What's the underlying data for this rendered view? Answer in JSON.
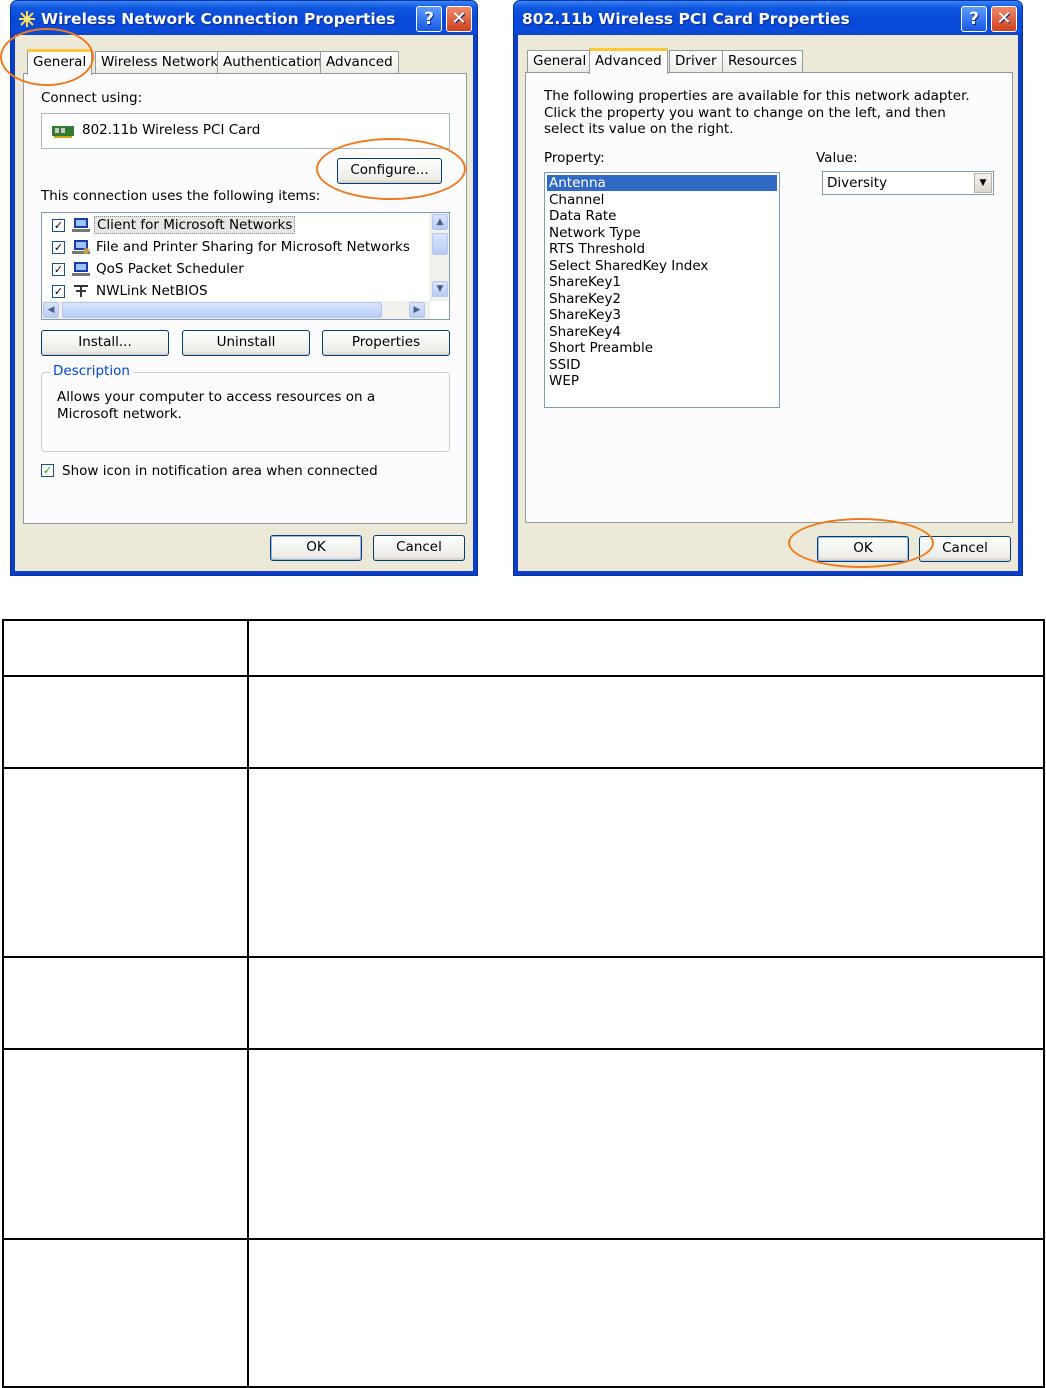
{
  "left_dialog": {
    "title": "Wireless Network Connection Properties",
    "help_glyph": "?",
    "close_glyph": "✕",
    "tabs": [
      {
        "label": "General",
        "active": true
      },
      {
        "label": "Wireless Networks",
        "active": false
      },
      {
        "label": "Authentication",
        "active": false
      },
      {
        "label": "Advanced",
        "active": false
      }
    ],
    "connect_using_label": "Connect using:",
    "adapter_name": "802.11b Wireless  PCI Card",
    "configure_label": "Configure...",
    "items_label": "This connection uses the following items:",
    "components": [
      {
        "label": "Client for Microsoft Networks",
        "checked": true,
        "selected": true,
        "icon": "network-client-icon"
      },
      {
        "label": "File and Printer Sharing for Microsoft Networks",
        "checked": true,
        "selected": false,
        "icon": "file-sharing-icon"
      },
      {
        "label": "QoS Packet Scheduler",
        "checked": true,
        "selected": false,
        "icon": "scheduler-icon"
      },
      {
        "label": "NWLink NetBIOS",
        "checked": true,
        "selected": false,
        "icon": "protocol-icon"
      }
    ],
    "install_label": "Install...",
    "uninstall_label": "Uninstall",
    "properties_label": "Properties",
    "description_legend": "Description",
    "description_text": "Allows your computer to access resources on a Microsoft network.",
    "show_icon_label": "Show icon in notification area when connected",
    "show_icon_checked": true,
    "ok_label": "OK",
    "cancel_label": "Cancel",
    "check_glyph": "✓"
  },
  "right_dialog": {
    "title": "802.11b Wireless PCI Card Properties",
    "help_glyph": "?",
    "close_glyph": "✕",
    "tabs": [
      {
        "label": "General",
        "active": false
      },
      {
        "label": "Advanced",
        "active": true
      },
      {
        "label": "Driver",
        "active": false
      },
      {
        "label": "Resources",
        "active": false
      }
    ],
    "intro_text": "The following properties are available for this network adapter. Click the property you want to change on the left, and then select its value on the right.",
    "property_label": "Property:",
    "value_label": "Value:",
    "properties": [
      "Antenna",
      "Channel",
      "Data Rate",
      "Network Type",
      "RTS Threshold",
      "Select SharedKey Index",
      "ShareKey1",
      "ShareKey2",
      "ShareKey3",
      "ShareKey4",
      "Short Preamble",
      "SSID",
      "WEP"
    ],
    "selected_property": "Antenna",
    "value_selected": "Diversity",
    "ok_label": "OK",
    "cancel_label": "Cancel"
  },
  "colors": {
    "highlight_ring": "#f07a20",
    "xp_title_blue": "#0848d6",
    "selection_blue": "#316ac5"
  },
  "table": {
    "rows": [
      [
        "",
        ""
      ],
      [
        "",
        ""
      ],
      [
        "",
        ""
      ],
      [
        "",
        ""
      ],
      [
        "",
        ""
      ],
      [
        "",
        ""
      ]
    ]
  }
}
